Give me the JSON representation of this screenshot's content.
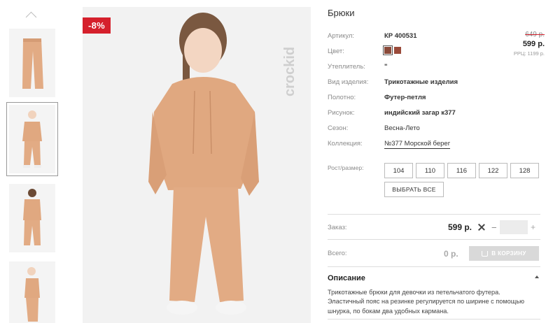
{
  "discount_badge": "-8%",
  "brand": "crockid",
  "product": {
    "title": "Брюки",
    "specs": [
      {
        "label": "Артикул:",
        "value": "КР 400531",
        "style": "bold"
      },
      {
        "label": "Цвет:",
        "value": "",
        "style": "swatch"
      },
      {
        "label": "Утеплитель:",
        "value": "\"",
        "style": "bold"
      },
      {
        "label": "Вид изделия:",
        "value": "Трикотажные изделия",
        "style": "bold"
      },
      {
        "label": "Полотно:",
        "value": "Футер-петля",
        "style": "bold"
      },
      {
        "label": "Рисунок:",
        "value": "индийский загар к377",
        "style": "bold"
      },
      {
        "label": "Сезон:",
        "value": "Весна-Лето",
        "style": "normal"
      },
      {
        "label": "Коллекция:",
        "value": "№377 Морской берег",
        "style": "link"
      }
    ],
    "colors": [
      "#8a4a3a",
      "#9a4a3a"
    ],
    "price": {
      "old": "649 р.",
      "new": "599 р.",
      "rrp": "РРЦ: 1199 р."
    },
    "size_label": "Рост/размер:",
    "sizes": [
      "104",
      "110",
      "116",
      "122",
      "128"
    ],
    "select_all": "ВЫБРАТЬ ВСЕ"
  },
  "order": {
    "label": "Заказ:",
    "price": "599 р.",
    "minus": "−",
    "plus": "+",
    "quantity": ""
  },
  "total": {
    "label": "Всего:",
    "value": "0 р.",
    "cart_button": "В КОРЗИНУ"
  },
  "description": {
    "heading": "Описание",
    "text": "Трикотажные брюки для девочки из петельчатого футера. Эластичный пояс на резинке регулируется по ширине с помощью шнурка, по бокам два удобных кармана."
  },
  "accent_color": "#d5202c",
  "product_color": "#e0a880"
}
